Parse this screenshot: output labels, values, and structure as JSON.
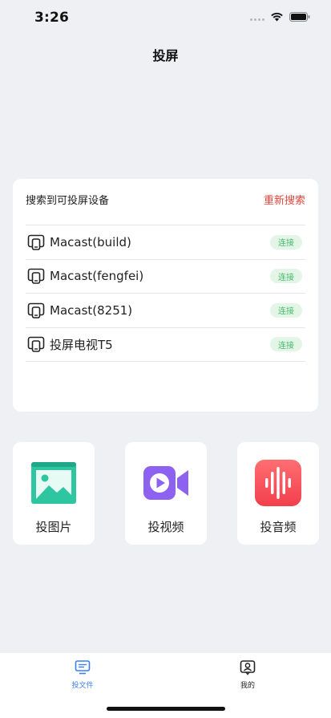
{
  "status_bar": {
    "time": "3:26"
  },
  "nav": {
    "title": "投屏"
  },
  "device_card": {
    "header_label": "搜索到可投屏设备",
    "rescan_label": "重新搜索",
    "devices": [
      {
        "name": "Macast(build)",
        "action": "连接"
      },
      {
        "name": "Macast(fengfei)",
        "action": "连接"
      },
      {
        "name": "Macast(8251)",
        "action": "连接"
      },
      {
        "name": "投屏电视T5",
        "action": "连接"
      }
    ]
  },
  "actions": [
    {
      "label": "投图片",
      "icon": "image-icon",
      "color": "#2ec5a1"
    },
    {
      "label": "投视频",
      "icon": "video-icon",
      "color": "#8d62f0"
    },
    {
      "label": "投音频",
      "icon": "audio-icon",
      "color": "#f8545c"
    }
  ],
  "tab_bar": {
    "tabs": [
      {
        "label": "投文件",
        "icon": "cast-file-icon",
        "active": true
      },
      {
        "label": "我的",
        "icon": "profile-icon",
        "active": false
      }
    ],
    "accent_color": "#3a7ef6"
  },
  "colors": {
    "background": "#eff0f4",
    "rescan": "#e8453c",
    "connect_bg": "#e3f5e7",
    "connect_text": "#48b96a"
  }
}
